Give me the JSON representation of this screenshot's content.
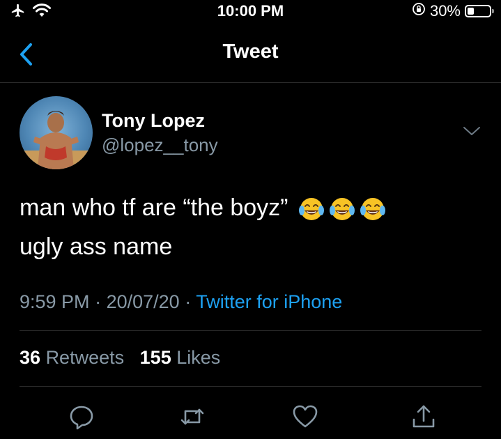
{
  "status_bar": {
    "time": "10:00 PM",
    "battery_percent": "30%",
    "battery_level": 0.3
  },
  "nav": {
    "title": "Tweet"
  },
  "tweet": {
    "author_name": "Tony Lopez",
    "author_handle": "@lopez__tony",
    "text_line1": "man who tf are “the boyz”",
    "text_line2": "ugly ass name",
    "emoji_count": 3,
    "time": "9:59 PM",
    "date": "20/07/20",
    "separator": "·",
    "source": "Twitter for iPhone",
    "retweet_count": "36",
    "retweet_label": "Retweets",
    "like_count": "155",
    "like_label": "Likes"
  },
  "icons": {
    "status": [
      "airplane-icon",
      "wifi-icon",
      "orientation-lock-icon",
      "battery-icon"
    ],
    "nav": [
      "back-chevron-icon"
    ],
    "tweet": [
      "caret-down-icon"
    ],
    "actions": [
      "reply-icon",
      "retweet-icon",
      "like-icon",
      "share-icon"
    ]
  },
  "colors": {
    "background": "#000000",
    "text": "#ffffff",
    "secondary_text": "#8899a6",
    "accent": "#1da1f2"
  }
}
